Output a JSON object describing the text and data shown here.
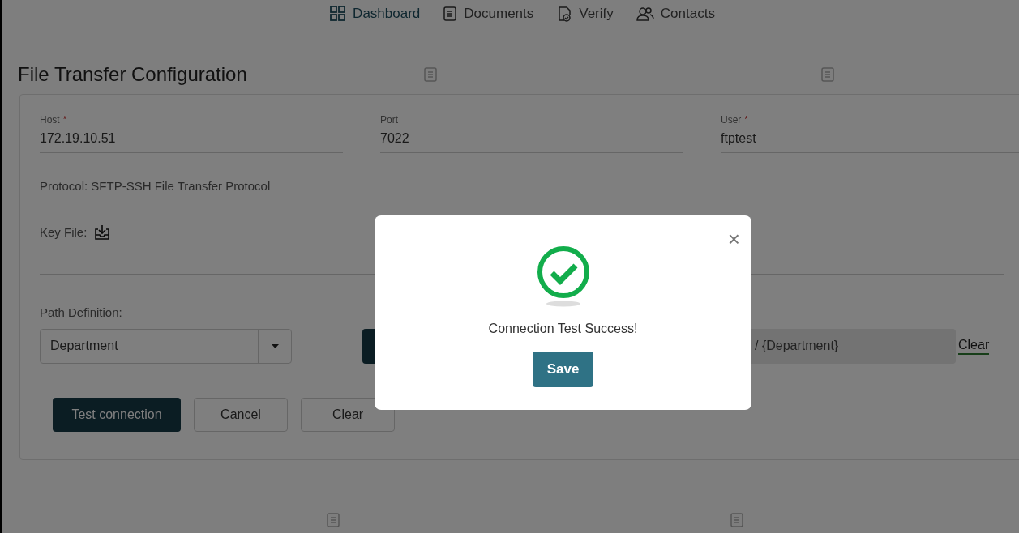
{
  "nav": [
    {
      "label": "Dashboard",
      "selected": true
    },
    {
      "label": "Documents",
      "selected": false
    },
    {
      "label": "Verify",
      "selected": false
    },
    {
      "label": "Contacts",
      "selected": false
    }
  ],
  "page_title": "File Transfer Configuration",
  "fields": [
    {
      "label": "Host",
      "required_mark": "*",
      "value": "172.19.10.51"
    },
    {
      "label": "Port",
      "value": "7022"
    },
    {
      "label": "User",
      "required_mark": "*",
      "value": "ftptest"
    }
  ],
  "protocol": "Protocol: SFTP-SSH File Transfer Protocol",
  "key_file": "Key File:",
  "path_definition": {
    "label": "Path Definition:",
    "value": "Department",
    "path": "/ {Department}",
    "clear": "Clear"
  },
  "buttons": [
    {
      "label": "Test connection",
      "kind": "primary"
    },
    {
      "label": "Cancel",
      "kind": "secondary"
    },
    {
      "label": "Clear",
      "kind": "secondary"
    }
  ],
  "dialog": {
    "close": "×",
    "message": "Connection Test Success!",
    "button": "Save"
  }
}
